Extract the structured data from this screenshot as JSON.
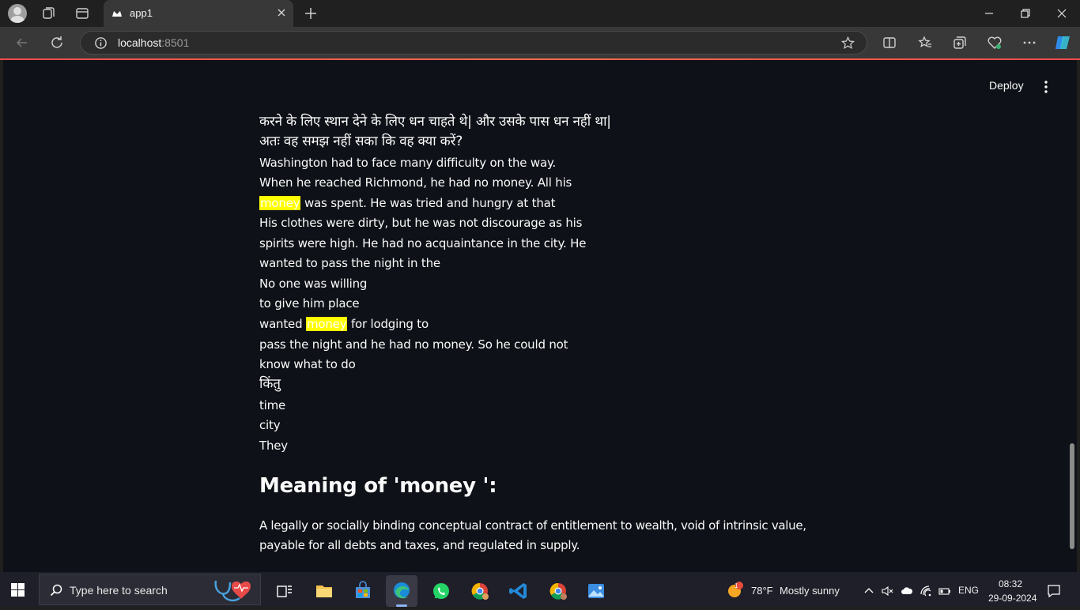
{
  "browser": {
    "tab_title": "app1",
    "url_host": "localhost",
    "url_port": ":8501"
  },
  "app": {
    "deploy_label": "Deploy",
    "lines": [
      {
        "parts": [
          {
            "text": "करने के लिए स्थान देने के लिए धन चाहते थे| और उसके पास धन नहीं था|",
            "hl": false
          }
        ],
        "hindi": true
      },
      {
        "parts": [
          {
            "text": "अतः वह समझ नहीं सका कि वह क्या करें?",
            "hl": false
          }
        ],
        "hindi": true
      },
      {
        "parts": [
          {
            "text": "Washington had to face many difficulty on the way.",
            "hl": false
          }
        ],
        "hindi": false
      },
      {
        "parts": [
          {
            "text": "When he reached Richmond, he had no money. All his",
            "hl": false
          }
        ],
        "hindi": false
      },
      {
        "parts": [
          {
            "text": "money",
            "hl": true
          },
          {
            "text": " was spent. He was tried and hungry at that",
            "hl": false
          }
        ],
        "hindi": false
      },
      {
        "parts": [
          {
            "text": "His clothes were dirty, but he was not discourage as his",
            "hl": false
          }
        ],
        "hindi": false
      },
      {
        "parts": [
          {
            "text": "spirits were high. He had no acquaintance in the city. He",
            "hl": false
          }
        ],
        "hindi": false
      },
      {
        "parts": [
          {
            "text": "wanted to pass the night in the",
            "hl": false
          }
        ],
        "hindi": false
      },
      {
        "parts": [
          {
            "text": "No one was willing",
            "hl": false
          }
        ],
        "hindi": false
      },
      {
        "parts": [
          {
            "text": "to give him place",
            "hl": false
          }
        ],
        "hindi": false
      },
      {
        "parts": [
          {
            "text": "wanted ",
            "hl": false
          },
          {
            "text": "money",
            "hl": true
          },
          {
            "text": " for lodging to",
            "hl": false
          }
        ],
        "hindi": false
      },
      {
        "parts": [
          {
            "text": "pass the night and he had no money. So he could not",
            "hl": false
          }
        ],
        "hindi": false
      },
      {
        "parts": [
          {
            "text": "know what to do",
            "hl": false
          }
        ],
        "hindi": false
      },
      {
        "parts": [
          {
            "text": "किंतु",
            "hl": false
          }
        ],
        "hindi": true
      },
      {
        "parts": [
          {
            "text": "time",
            "hl": false
          }
        ],
        "hindi": false
      },
      {
        "parts": [
          {
            "text": "city",
            "hl": false
          }
        ],
        "hindi": false
      },
      {
        "parts": [
          {
            "text": "They",
            "hl": false
          }
        ],
        "hindi": false
      }
    ],
    "meaning_heading": "Meaning of 'money ':",
    "meaning_text": "A legally or socially binding conceptual contract of entitlement to wealth, void of intrinsic value, payable for all debts and taxes, and regulated in supply."
  },
  "taskbar": {
    "search_placeholder": "Type here to search",
    "weather_temp": "78°F",
    "weather_desc": "Mostly sunny",
    "weather_badge": "1",
    "language": "ENG",
    "time": "08:32",
    "date": "29-09-2024"
  },
  "colors": {
    "page_bg": "#0e1117",
    "highlight": "#ffff00",
    "accent_line": "#ff4b4b"
  }
}
